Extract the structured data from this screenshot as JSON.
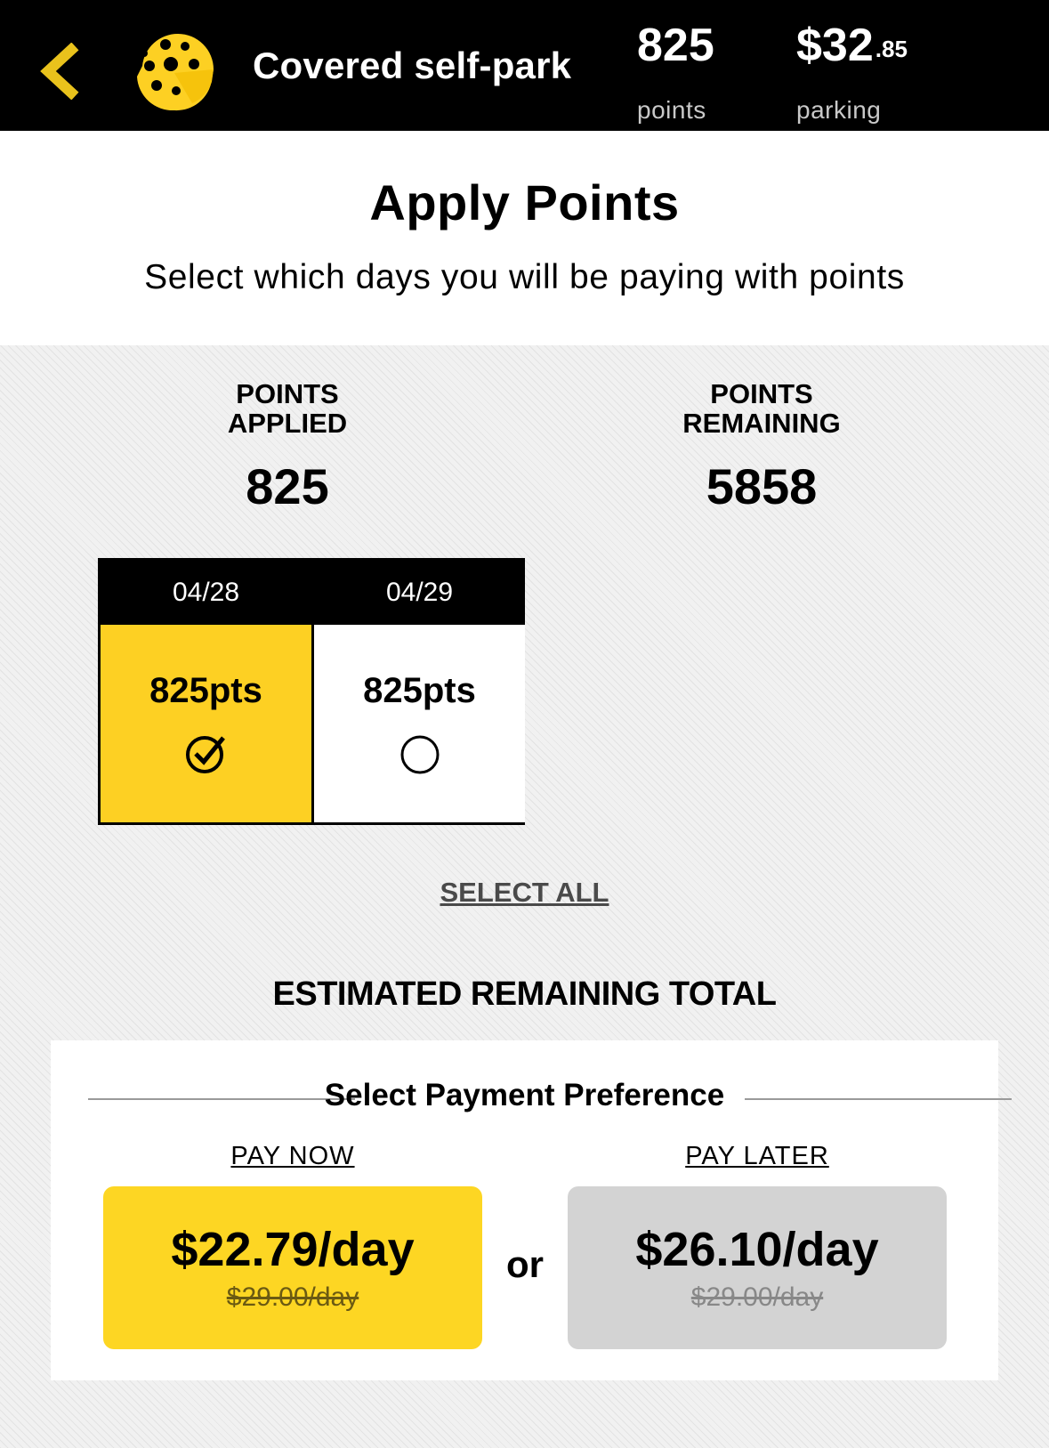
{
  "header": {
    "title": "Covered self-park",
    "back_icon": "chevron-left-icon",
    "logo_icon": "cheese-wheel-logo",
    "points_value": "825",
    "points_label": "points",
    "parking_dollars": "$32",
    "parking_cents": ".85",
    "parking_label": "parking",
    "accent_color": "#fdd023"
  },
  "intro": {
    "title": "Apply Points",
    "subtitle": "Select which days you will be paying with points"
  },
  "counters": {
    "applied_label_1": "POINTS",
    "applied_label_2": "APPLIED",
    "applied_value": "825",
    "remaining_label_1": "POINTS",
    "remaining_label_2": "REMAINING",
    "remaining_value": "5858"
  },
  "days": [
    {
      "date": "04/28",
      "points": "825pts",
      "selected": true
    },
    {
      "date": "04/29",
      "points": "825pts",
      "selected": false
    }
  ],
  "select_all": "SELECT ALL",
  "estimate": {
    "title": "ESTIMATED REMAINING TOTAL",
    "preference_title": "Select Payment Preference",
    "or_label": "or",
    "pay_now": {
      "label": "PAY NOW",
      "price": "$22.79/day",
      "original": "$29.00/day"
    },
    "pay_later": {
      "label": "PAY LATER",
      "price": "$26.10/day",
      "original": "$29.00/day"
    }
  }
}
